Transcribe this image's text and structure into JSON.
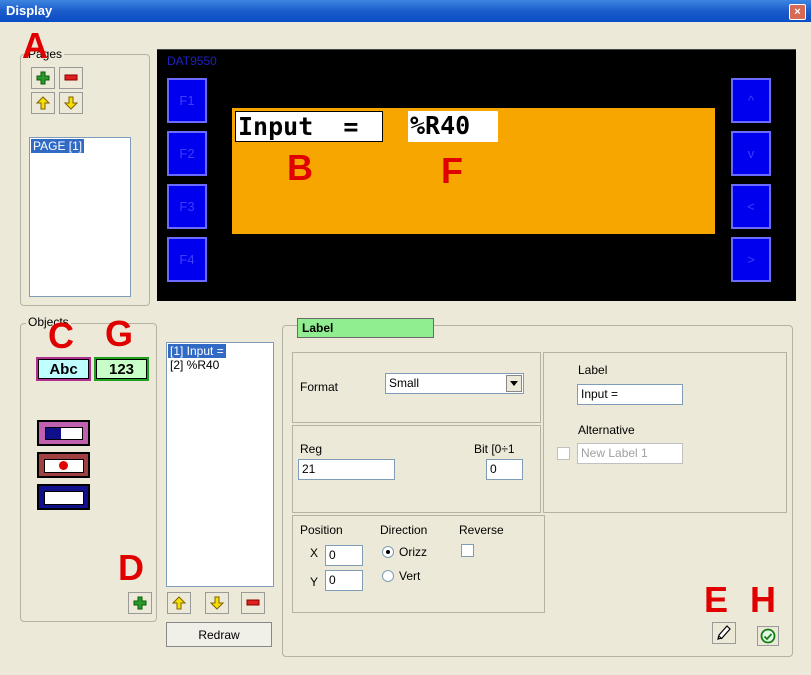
{
  "window": {
    "title": "Display",
    "close_label": "×"
  },
  "pages": {
    "legend": "Pages",
    "items": [
      "PAGE [1]"
    ]
  },
  "lcd": {
    "model_label": "DAT9550",
    "left_keys": [
      "F1",
      "F2",
      "F3",
      "F4"
    ],
    "right_keys": [
      "^",
      "v",
      "<",
      ">"
    ],
    "label_text": "Input  =",
    "value_text": "%R40",
    "background_color": "#f7a600"
  },
  "objects": {
    "legend": "Objects",
    "text_button": "Abc",
    "number_button": "123",
    "list": [
      "[1] Input =",
      "[2] %R40"
    ],
    "redraw_label": "Redraw"
  },
  "properties": {
    "header": "Label",
    "format_label": "Format",
    "format_value": "Small",
    "reg_label": "Reg",
    "reg_value": "21",
    "bit_label": "Bit [0÷1",
    "bit_value": "0",
    "label_label": "Label",
    "label_value": "Input =",
    "alternative_label": "Alternative",
    "alternative_value": "New Label 1",
    "position_label": "Position",
    "x_label": "X",
    "x_value": "0",
    "y_label": "Y",
    "y_value": "0",
    "direction_label": "Direction",
    "orizz_label": "Orizz",
    "vert_label": "Vert",
    "reverse_label": "Reverse"
  },
  "annotations": {
    "A": "A",
    "B": "B",
    "C": "C",
    "D": "D",
    "E": "E",
    "F": "F",
    "G": "G",
    "H": "H"
  },
  "colors": {
    "annotation": "#e00000",
    "lcd_key": "#0000ee",
    "header_green": "#90ee90",
    "selection": "#316ac5"
  }
}
